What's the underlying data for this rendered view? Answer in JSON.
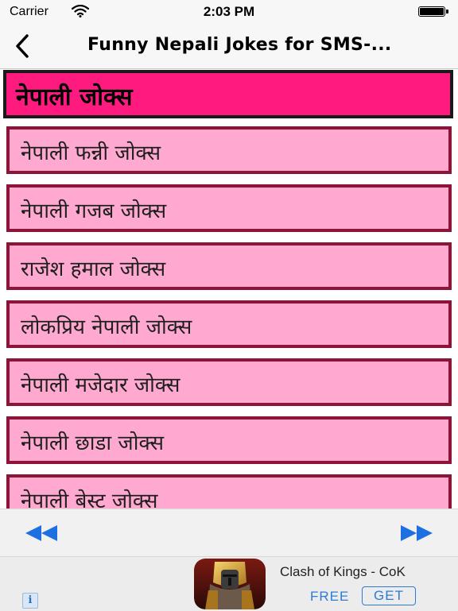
{
  "status_bar": {
    "carrier": "Carrier",
    "time": "2:03 PM"
  },
  "nav": {
    "title": "Funny Nepali Jokes for SMS-..."
  },
  "header": {
    "title": "नेपाली जोक्स"
  },
  "list": {
    "items": [
      {
        "label": "नेपाली फन्नी जोक्स"
      },
      {
        "label": "नेपाली गजब जोक्स"
      },
      {
        "label": "राजेश हमाल जोक्स"
      },
      {
        "label": "लोकप्रिय नेपाली जोक्स"
      },
      {
        "label": "नेपाली मजेदार जोक्स"
      },
      {
        "label": "नेपाली छाडा जोक्स"
      },
      {
        "label": "नेपाली बेस्ट जोक्स"
      }
    ]
  },
  "pager": {
    "previous_icon": "rewind-icon",
    "next_icon": "fastforward-icon",
    "accent": "#1e6fe0"
  },
  "ad": {
    "app_name": "Clash of Kings - CoK",
    "price": "FREE",
    "button_label": "GET",
    "info_label": "i",
    "accent": "#2c7bd6"
  },
  "colors": {
    "header_bg": "#ff1a80",
    "item_bg": "#ffa9d0",
    "item_border": "#8c1436"
  }
}
